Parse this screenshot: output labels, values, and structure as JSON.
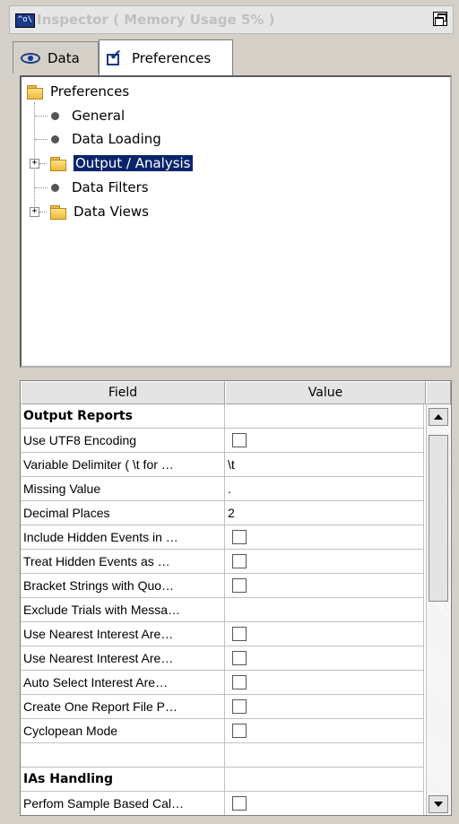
{
  "window": {
    "title": "Inspector ( Memory Usage 5% )",
    "title_icon": "inspector-icon",
    "restore_icon": "restore-icon"
  },
  "tabs": [
    {
      "label": "Data",
      "icon": "eye-icon",
      "active": false
    },
    {
      "label": "Preferences",
      "icon": "checkbox-checked-icon",
      "active": true
    }
  ],
  "tree": {
    "root": "Preferences",
    "items": [
      {
        "label": "General",
        "type": "leaf"
      },
      {
        "label": "Data Loading",
        "type": "leaf"
      },
      {
        "label": "Output / Analysis",
        "type": "folder",
        "expandable": true,
        "selected": true
      },
      {
        "label": "Data Filters",
        "type": "leaf"
      },
      {
        "label": "Data Views",
        "type": "folder",
        "expandable": true
      }
    ]
  },
  "table": {
    "headers": {
      "field": "Field",
      "value": "Value"
    },
    "rows": [
      {
        "field": "Output Reports",
        "kind": "section",
        "value": ""
      },
      {
        "field": "Use UTF8 Encoding",
        "kind": "checkbox",
        "value": ""
      },
      {
        "field": "Variable Delimiter ( \\t for …",
        "kind": "text",
        "value": "\\t"
      },
      {
        "field": "Missing Value",
        "kind": "text",
        "value": "."
      },
      {
        "field": "Decimal Places",
        "kind": "text",
        "value": "2"
      },
      {
        "field": "Include Hidden Events in …",
        "kind": "checkbox",
        "value": ""
      },
      {
        "field": "Treat Hidden Events as …",
        "kind": "checkbox",
        "value": ""
      },
      {
        "field": "Bracket Strings with Quo…",
        "kind": "checkbox",
        "value": ""
      },
      {
        "field": "Exclude Trials with Messa…",
        "kind": "text",
        "value": ""
      },
      {
        "field": "Use Nearest Interest Are…",
        "kind": "checkbox",
        "value": ""
      },
      {
        "field": "Use Nearest Interest Are…",
        "kind": "checkbox",
        "value": ""
      },
      {
        "field": "Auto Select Interest Are…",
        "kind": "checkbox",
        "value": ""
      },
      {
        "field": "Create One Report File P…",
        "kind": "checkbox",
        "value": ""
      },
      {
        "field": "Cyclopean Mode",
        "kind": "checkbox",
        "value": ""
      },
      {
        "field": "",
        "kind": "text",
        "value": ""
      },
      {
        "field": "IAs Handling",
        "kind": "section",
        "value": ""
      },
      {
        "field": "Perfom Sample Based Cal…",
        "kind": "checkbox",
        "value": ""
      }
    ]
  },
  "colors": {
    "selection": "#0a246a",
    "panel_bg": "#d4d0c8",
    "folder": "#f0b83a"
  }
}
